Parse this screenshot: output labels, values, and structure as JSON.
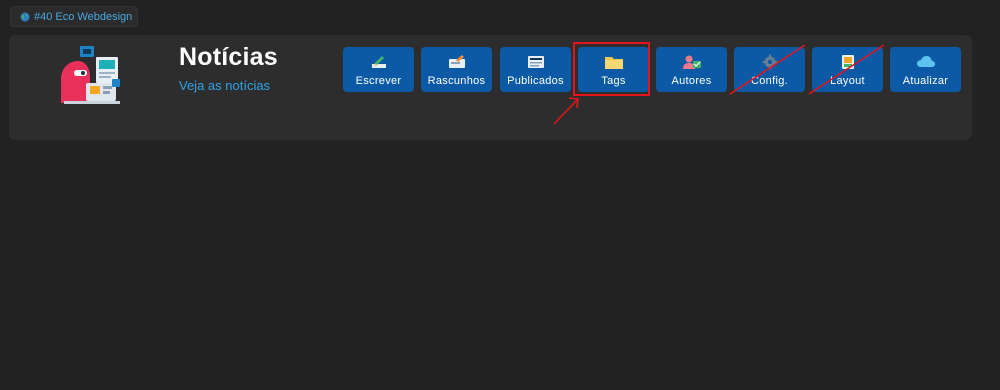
{
  "site": {
    "label": "#40 Eco Webdesign",
    "icon": "globe-icon"
  },
  "header": {
    "title": "Notícias",
    "subtitle": "Veja as notícias",
    "illustration": "news-illustration-icon"
  },
  "toolbar": {
    "buttons": [
      {
        "label": "Escrever",
        "icon": "pen-icon"
      },
      {
        "label": "Rascunhos",
        "icon": "draft-icon"
      },
      {
        "label": "Publicados",
        "icon": "published-icon"
      },
      {
        "label": "Tags",
        "icon": "folder-icon",
        "highlighted": true
      },
      {
        "label": "Autores",
        "icon": "authors-icon"
      },
      {
        "label": "Config.",
        "icon": "gear-icon",
        "crossed_out": true
      },
      {
        "label": "Layout",
        "icon": "layout-icon",
        "crossed_out": true
      },
      {
        "label": "Atualizar",
        "icon": "cloud-icon"
      }
    ]
  },
  "colors": {
    "background": "#222222",
    "panel": "#2d2d2d",
    "button": "#0c5aa6",
    "accent_text": "#2ea3e6",
    "annotation": "#e3141b"
  }
}
